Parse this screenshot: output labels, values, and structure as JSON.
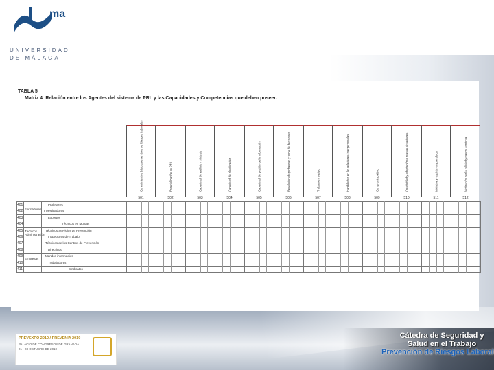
{
  "header": {
    "logo_mark": "ma",
    "university": "UNIVERSIDAD\nDE MÁLAGA"
  },
  "table": {
    "title": "TABLA 5",
    "subtitle": "Matriz 4: Relación entre los Agentes del sistema de PRL y las Capacidades y Competencias que deben poseer.",
    "columns": [
      {
        "code": "501",
        "label": "Conocimientos básicos en el área de Riesgos Laborales"
      },
      {
        "code": "502",
        "label": "Especialización en PRL"
      },
      {
        "code": "503",
        "label": "Capacidad de análisis y síntesis"
      },
      {
        "code": "504",
        "label": "Capacidad de planificación"
      },
      {
        "code": "505",
        "label": "Capacidad de gestión de la información"
      },
      {
        "code": "506",
        "label": "Resolución de problemas y toma de decisiones"
      },
      {
        "code": "507",
        "label": "Trabajo en equipo"
      },
      {
        "code": "508",
        "label": "Habilidades en las relaciones interpersonales"
      },
      {
        "code": "509",
        "label": "Compromiso ético"
      },
      {
        "code": "510",
        "label": "Creatividad y adaptación a nuevas situaciones"
      },
      {
        "code": "511",
        "label": "Iniciativa y espíritu emprendedor"
      },
      {
        "code": "512",
        "label": "Motivación por la calidad y mejora continua"
      }
    ],
    "row_groups": {
      "formadores": "Formadores",
      "tecnicos": "Técnicos Administración",
      "empresas": "Empresas"
    },
    "rows": [
      {
        "code": "401",
        "label": "Profesores"
      },
      {
        "code": "402",
        "label": "Investigadores"
      },
      {
        "code": "403",
        "label": "Expertos"
      },
      {
        "code": "404",
        "label": "Técnicos en Mutuas"
      },
      {
        "code": "405",
        "label": "Técnicos Servicios de Prevención"
      },
      {
        "code": "406",
        "label": "Inspectores de Trabajo"
      },
      {
        "code": "407",
        "label": "Técnicos de los Centros de Prevención"
      },
      {
        "code": "408",
        "label": "Directivos"
      },
      {
        "code": "409",
        "label": "Mandos intermedios"
      },
      {
        "code": "410",
        "label": "Trabajadores"
      },
      {
        "code": "411",
        "label": "Sindicatos"
      }
    ]
  },
  "footer": {
    "event_line1": "PREVEXPO 2010 / PREVENIA 2010",
    "event_line2": "PALACIO DE CONGRESOS DE GRANADA",
    "event_line3": "21 - 23 OCTUBRE DE 2010",
    "catedra_line1": "Cátedra de Seguridad y",
    "catedra_line2": "Salud en el Trabajo",
    "catedra_line3": "Prevención de Riesgos Laborales"
  },
  "colors": {
    "accent_red": "#b03030",
    "brand_blue": "#1d4f86",
    "catedra_blue": "#1e63b8",
    "gold": "#d4a62a"
  }
}
